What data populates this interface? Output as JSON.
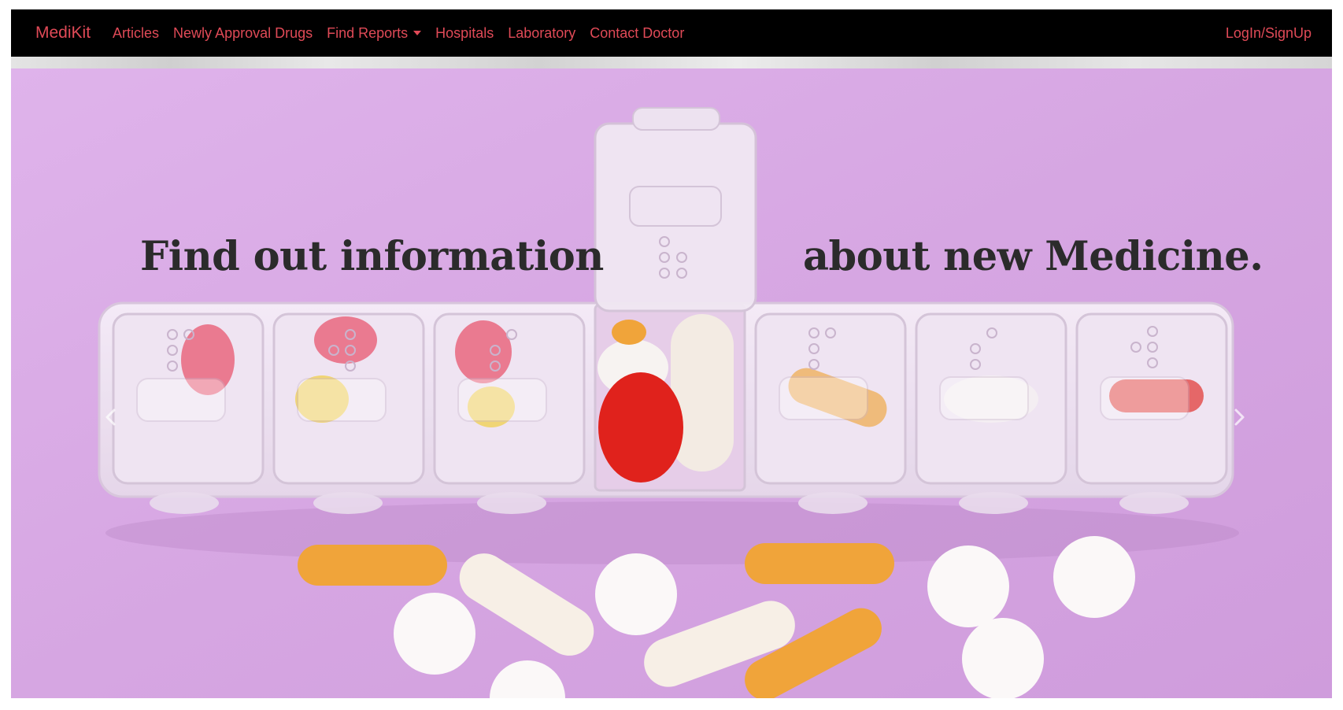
{
  "navbar": {
    "brand": "MediKit",
    "links": [
      "Articles",
      "Newly Approval Drugs",
      "Find Reports",
      "Hospitals",
      "Laboratory",
      "Contact Doctor"
    ],
    "login": "LogIn/SignUp"
  },
  "hero": {
    "headline_left": "Find out information",
    "headline_right": "about new Medicine."
  },
  "carousel": {
    "prev_icon": "chevron-left-icon",
    "next_icon": "chevron-right-icon"
  },
  "colors": {
    "nav_bg": "#000000",
    "link_color": "#e04a57",
    "hero_bg": "#d8a8e4",
    "headline_color": "#2b2b2b"
  }
}
